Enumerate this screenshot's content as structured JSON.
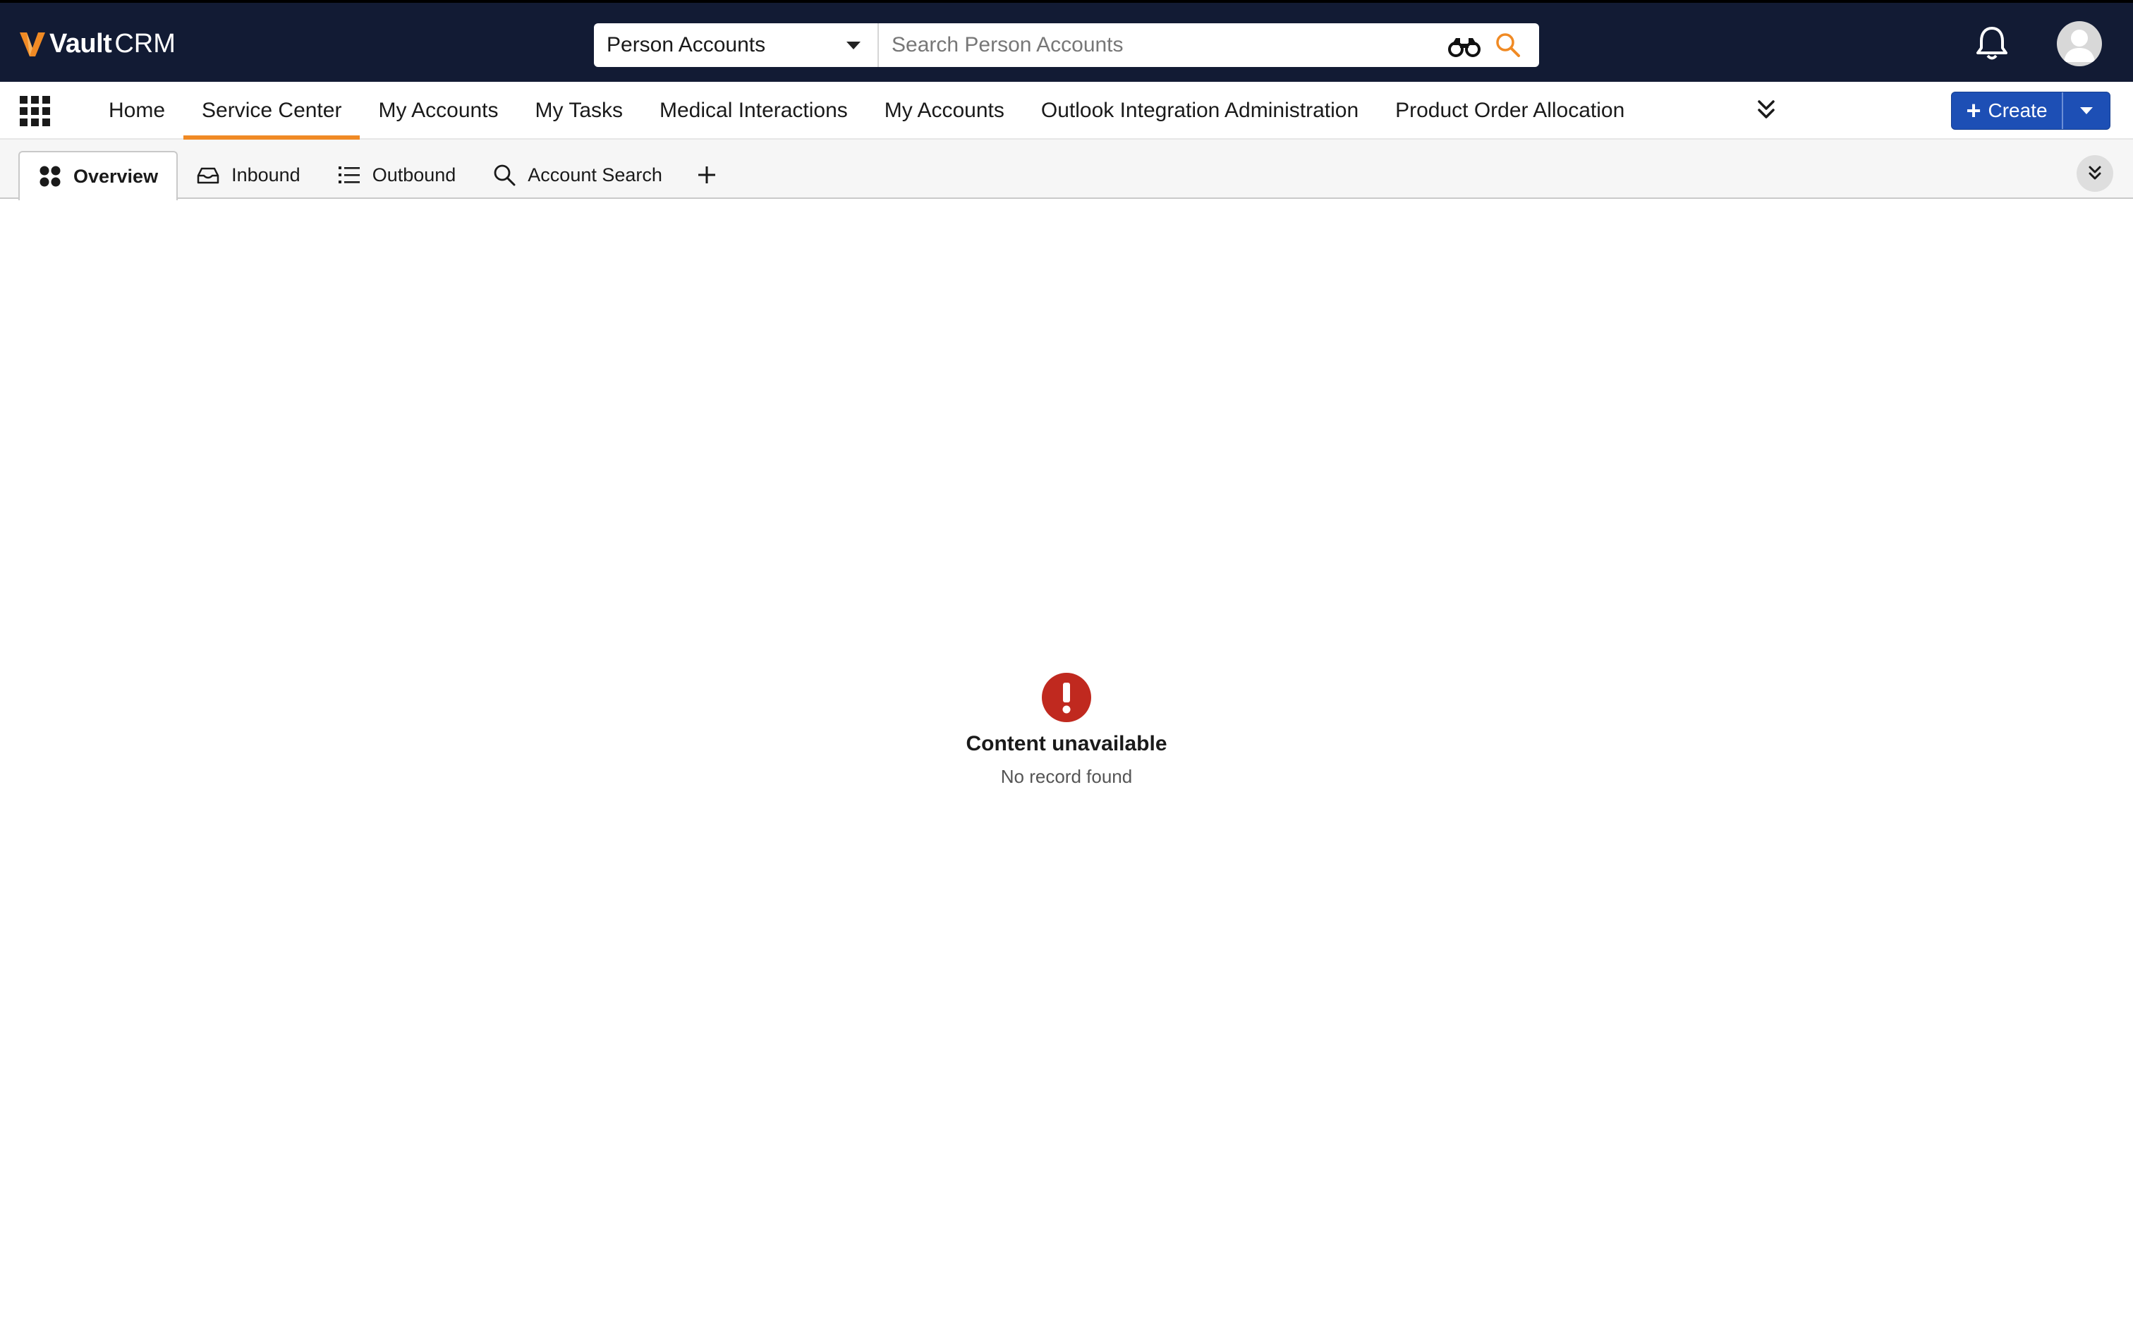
{
  "brand": {
    "name_bold": "Vault",
    "name_light": "CRM",
    "accent_color": "#f08a24",
    "header_bg": "#121b34"
  },
  "search": {
    "object_selected": "Person Accounts",
    "placeholder": "Search Person Accounts",
    "value": ""
  },
  "header_icons": [
    "bell-icon",
    "user-avatar-icon",
    "binoculars-icon",
    "search-icon"
  ],
  "nav": {
    "items": [
      {
        "label": "Home",
        "active": false
      },
      {
        "label": "Service Center",
        "active": true
      },
      {
        "label": "My Accounts",
        "active": false
      },
      {
        "label": "My Tasks",
        "active": false
      },
      {
        "label": "Medical Interactions",
        "active": false
      },
      {
        "label": "My Accounts",
        "active": false
      },
      {
        "label": "Outlook Integration Administration",
        "active": false
      },
      {
        "label": "Product Order Allocation",
        "active": false
      }
    ],
    "create_label": "Create",
    "create_color": "#1d4fb5"
  },
  "tabs": {
    "items": [
      {
        "label": "Overview",
        "icon": "grid-dots-icon",
        "active": true
      },
      {
        "label": "Inbound",
        "icon": "inbox-icon",
        "active": false
      },
      {
        "label": "Outbound",
        "icon": "list-icon",
        "active": false
      },
      {
        "label": "Account Search",
        "icon": "search-icon",
        "active": false
      }
    ]
  },
  "empty_state": {
    "icon": "error-exclamation-icon",
    "icon_color": "#c0291f",
    "title": "Content unavailable",
    "subtitle": "No record found"
  }
}
